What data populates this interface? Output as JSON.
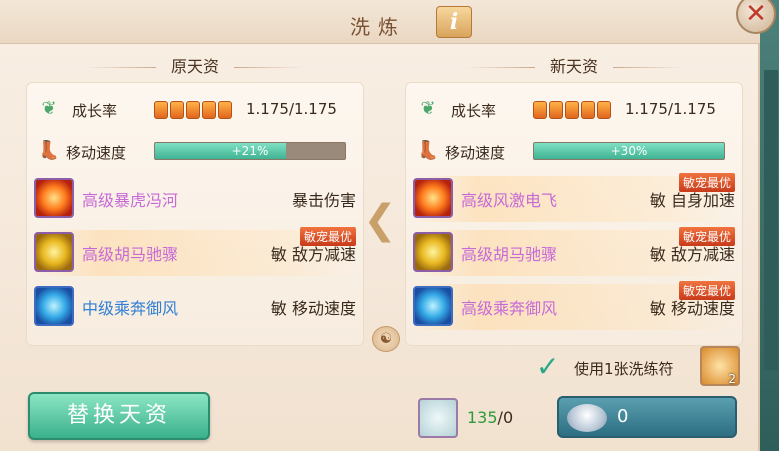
{
  "window": {
    "title": "洗炼",
    "info_icon": "i",
    "close_icon": "✕"
  },
  "left": {
    "header": "原天资",
    "growth": {
      "label": "成长率",
      "pips": 5,
      "value": "1.175/1.175"
    },
    "speed": {
      "label": "移动速度",
      "percent_text": "+21%",
      "fill": 0.69
    },
    "skills": [
      {
        "name": "高级暴虎冯河",
        "effect": "暴击伤害",
        "badge": "",
        "name_color": "#c76ad6",
        "icon": "fire"
      },
      {
        "name": "高级胡马驰骤",
        "effect": "敏 敌方减速",
        "badge": "敏宠最优",
        "name_color": "#c76ad6",
        "icon": "gold"
      },
      {
        "name": "中级乘奔御风",
        "effect": "敏 移动速度",
        "badge": "",
        "name_color": "#2f7fd6",
        "icon": "blue"
      }
    ]
  },
  "right": {
    "header": "新天资",
    "growth": {
      "label": "成长率",
      "pips": 5,
      "value": "1.175/1.175"
    },
    "speed": {
      "label": "移动速度",
      "percent_text": "+30%",
      "fill": 1.0
    },
    "skills": [
      {
        "name": "高级风激电飞",
        "effect": "敏 自身加速",
        "badge": "敏宠最优",
        "name_color": "#c76ad6",
        "icon": "fire"
      },
      {
        "name": "高级胡马驰骤",
        "effect": "敏 敌方减速",
        "badge": "敏宠最优",
        "name_color": "#c76ad6",
        "icon": "gold"
      },
      {
        "name": "高级乘奔御风",
        "effect": "敏 移动速度",
        "badge": "敏宠最优",
        "name_color": "#c76ad6",
        "icon": "blue"
      }
    ]
  },
  "use_option": {
    "label": "使用1张洗练符",
    "checked": true,
    "item_count": "2"
  },
  "replace_button": "替换天资",
  "material": {
    "have": "135",
    "need": "/0"
  },
  "silver": {
    "value": "0"
  }
}
